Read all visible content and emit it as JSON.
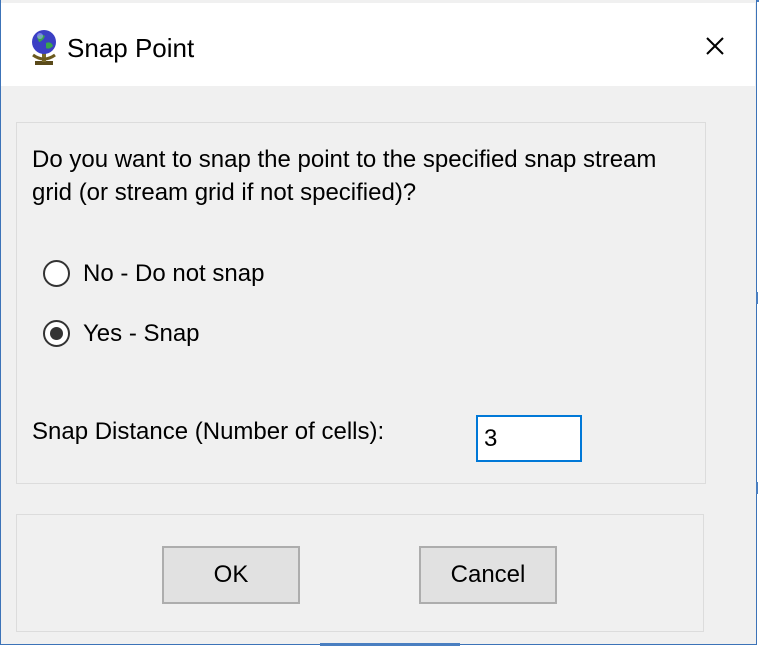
{
  "window": {
    "title": "Snap Point",
    "icon": "globe-on-stand-icon",
    "close_icon": "close-icon"
  },
  "question": "Do you want to snap the point to the specified snap stream grid (or stream grid if not specified)?",
  "options": [
    {
      "label": "No - Do not snap",
      "selected": false
    },
    {
      "label": "Yes - Snap",
      "selected": true
    }
  ],
  "snap_distance": {
    "label": "Snap Distance (Number of cells):",
    "value": "3"
  },
  "buttons": {
    "ok": "OK",
    "cancel": "Cancel"
  },
  "colors": {
    "accent": "#0078d7",
    "window_border": "#3c73b8",
    "dialog_bg": "#f0f0f0",
    "button_bg": "#e1e1e1"
  }
}
